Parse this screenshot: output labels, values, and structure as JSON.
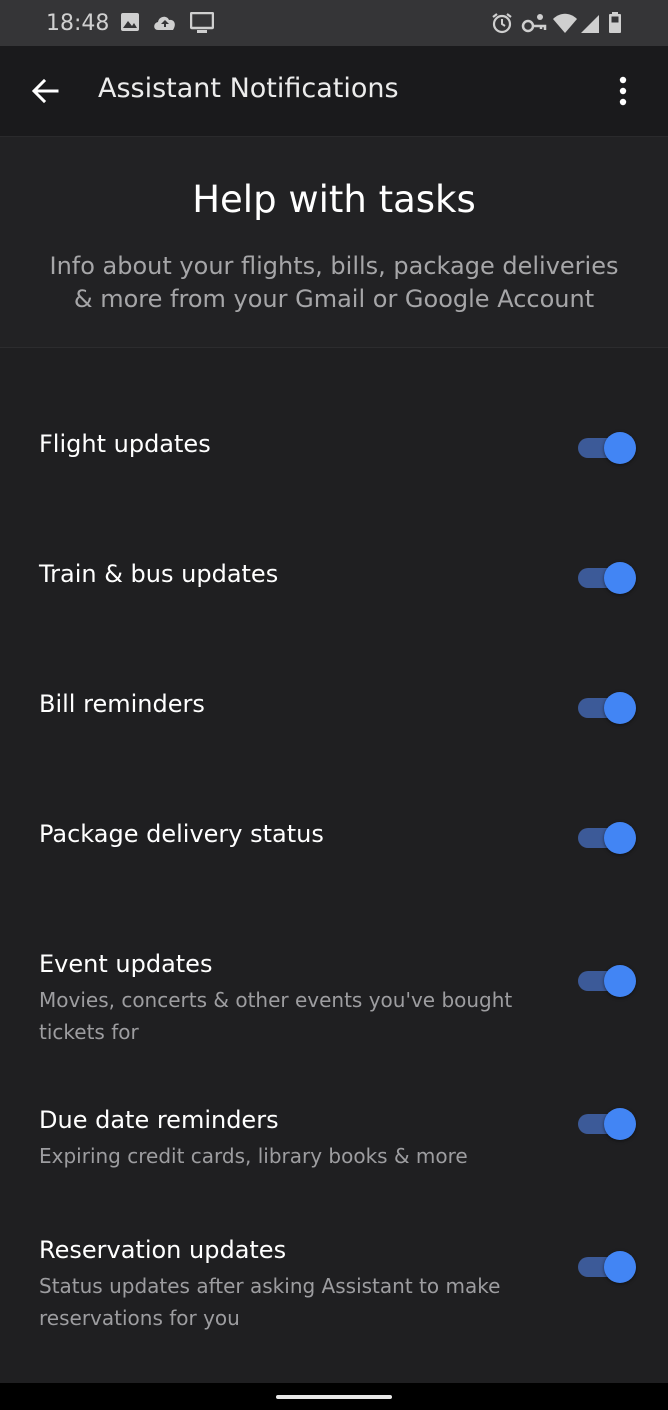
{
  "status_bar": {
    "time": "18:48",
    "left_icons": [
      "image-icon",
      "cloud-icon",
      "cast-icon"
    ],
    "right_icons": [
      "alarm-icon",
      "vpn-key-icon",
      "wifi-icon",
      "signal-icon",
      "battery-icon"
    ]
  },
  "app_bar": {
    "title": "Assistant Notifications",
    "back_icon": "back-arrow-icon",
    "menu_icon": "overflow-menu-icon"
  },
  "header": {
    "title": "Help with tasks",
    "subtitle": "Info about your flights, bills, package deliveries & more from your Gmail or Google Account"
  },
  "settings": [
    {
      "label": "Flight updates",
      "description": "",
      "enabled": true
    },
    {
      "label": "Train & bus updates",
      "description": "",
      "enabled": true
    },
    {
      "label": "Bill reminders",
      "description": "",
      "enabled": true
    },
    {
      "label": "Package delivery status",
      "description": "",
      "enabled": true
    },
    {
      "label": "Event updates",
      "description": "Movies, concerts & other events you've bought tickets for",
      "enabled": true
    },
    {
      "label": "Due date reminders",
      "description": "Expiring credit cards, library books & more",
      "enabled": true
    },
    {
      "label": "Reservation updates",
      "description": "Status updates after asking Assistant to make reservations for you",
      "enabled": true
    }
  ],
  "colors": {
    "accent": "#4285f4",
    "track": "#3c5a98",
    "background": "#1f1f21",
    "status_bar": "#353537"
  }
}
